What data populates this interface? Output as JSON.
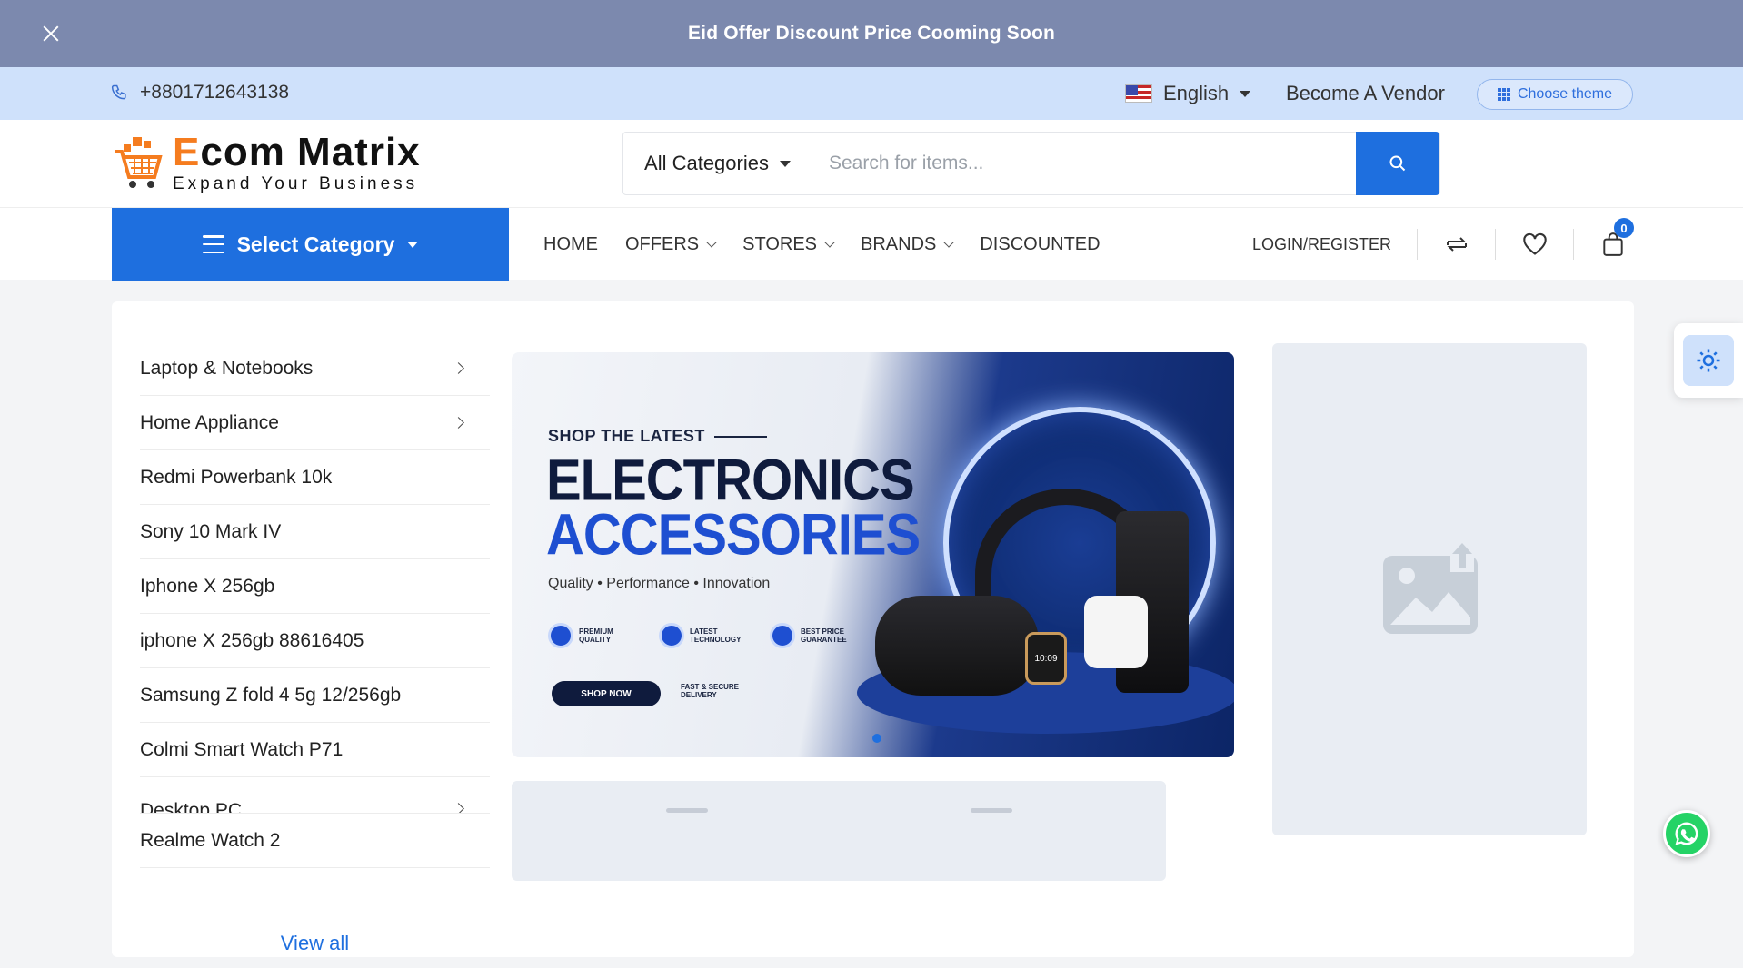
{
  "announcement": {
    "message": "Eid Offer Discount Price Cooming Soon"
  },
  "topbar": {
    "phone": "+8801712643138",
    "language": "English",
    "become_vendor": "Become A Vendor",
    "choose_theme": "Choose theme"
  },
  "header": {
    "logo_name_accent": "E",
    "logo_name_rest": "com Matrix",
    "logo_tagline": "Expand Your Business",
    "search_category": "All Categories",
    "search_placeholder": "Search for items..."
  },
  "nav": {
    "select_category": "Select Category",
    "items": [
      {
        "label": "HOME"
      },
      {
        "label": "OFFERS"
      },
      {
        "label": "STORES"
      },
      {
        "label": "BRANDS"
      },
      {
        "label": "DISCOUNTED"
      }
    ],
    "login": "LOGIN/REGISTER",
    "cart_count": "0"
  },
  "categories": [
    {
      "label": "Laptop & Notebooks"
    },
    {
      "label": "Home Appliance"
    },
    {
      "label": "Redmi Powerbank 10k"
    },
    {
      "label": "Sony 10 Mark IV"
    },
    {
      "label": "Iphone X 256gb"
    },
    {
      "label": "iphone X 256gb 88616405"
    },
    {
      "label": "Samsung Z fold 4 5g 12/256gb"
    },
    {
      "label": "Colmi Smart Watch P71"
    },
    {
      "label": "Desktop PC"
    },
    {
      "label": "Realme Watch 2"
    }
  ],
  "view_all": "View all",
  "banner": {
    "kicker": "SHOP THE LATEST",
    "line1": "ELECTRONICS",
    "line2": "ACCESSORIES",
    "subtitle": "Quality • Performance • Innovation",
    "features": [
      {
        "text": "PREMIUM QUALITY"
      },
      {
        "text": "LATEST TECHNOLOGY"
      },
      {
        "text": "BEST PRICE GUARANTEE"
      }
    ],
    "shop_now": "SHOP NOW",
    "delivery": "FAST & SECURE DELIVERY",
    "watch_time": "10:09"
  },
  "colors": {
    "primary": "#1e6fdf",
    "announce_bg": "#7c89ae",
    "topbar_bg": "#cfe1fb",
    "logo_accent": "#f57c1f"
  }
}
